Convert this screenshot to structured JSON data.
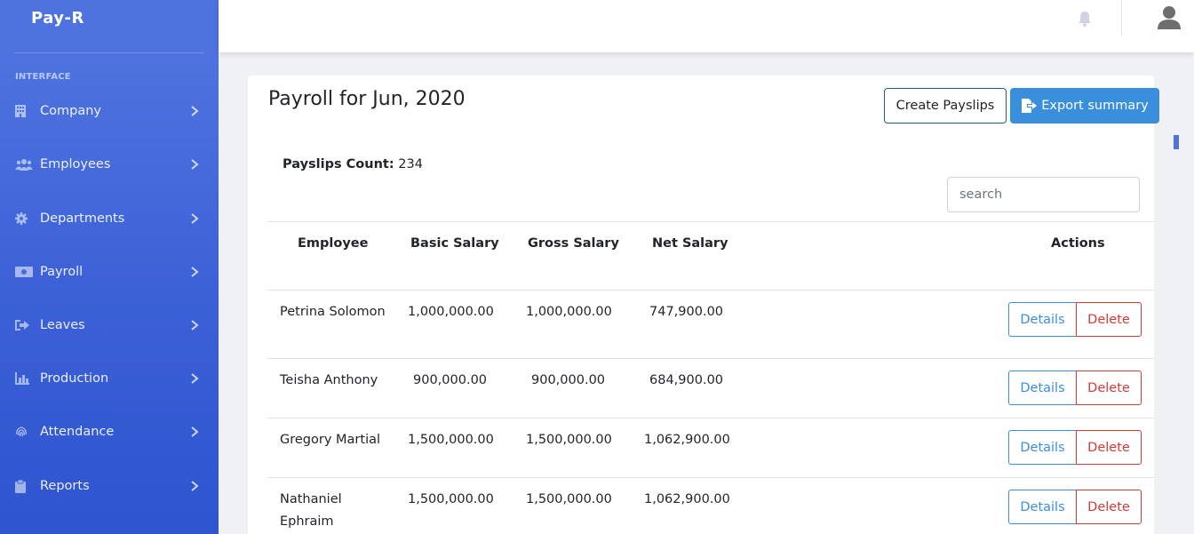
{
  "brand": "Pay-R",
  "sidebar": {
    "heading": "INTERFACE",
    "items": [
      {
        "label": "Company",
        "icon": "building-icon"
      },
      {
        "label": "Employees",
        "icon": "users-icon"
      },
      {
        "label": "Departments",
        "icon": "gear-icon"
      },
      {
        "label": "Payroll",
        "icon": "money-icon"
      },
      {
        "label": "Leaves",
        "icon": "sign-out-icon"
      },
      {
        "label": "Production",
        "icon": "chart-icon"
      },
      {
        "label": "Attendance",
        "icon": "fingerprint-icon"
      },
      {
        "label": "Reports",
        "icon": "clipboard-icon"
      }
    ]
  },
  "main": {
    "title": "Payroll for Jun, 2020",
    "create_label": "Create Payslips",
    "export_label": "Export summary",
    "count_label": "Payslips Count:",
    "count_value": "234",
    "search_placeholder": "search",
    "columns": [
      "Employee",
      "Basic Salary",
      "Gross Salary",
      "Net Salary",
      "Actions"
    ],
    "rows": [
      {
        "employee": "Petrina Solomon",
        "basic": "1,000,000.00",
        "gross": "1,000,000.00",
        "net": "747,900.00"
      },
      {
        "employee": "Teisha Anthony",
        "basic": "900,000.00",
        "gross": "900,000.00",
        "net": "684,900.00"
      },
      {
        "employee": "Gregory Martial",
        "basic": "1,500,000.00",
        "gross": "1,500,000.00",
        "net": "1,062,900.00"
      },
      {
        "employee": "Nathaniel Ephraim",
        "basic": "1,500,000.00",
        "gross": "1,500,000.00",
        "net": "1,062,900.00"
      }
    ],
    "details_label": "Details",
    "delete_label": "Delete"
  },
  "colors": {
    "sidebar": "#4e73df",
    "primary": "#3a8fdc",
    "danger": "#d33a3a"
  }
}
